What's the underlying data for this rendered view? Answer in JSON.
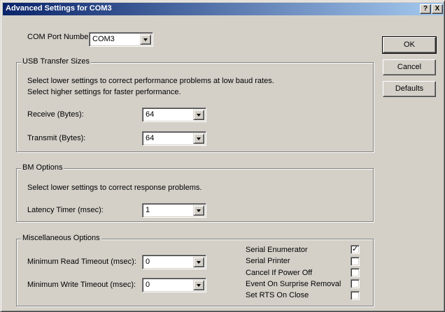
{
  "window": {
    "title": "Advanced Settings for COM3",
    "help_glyph": "?",
    "close_glyph": "X"
  },
  "com_port": {
    "label": "COM Port Number:",
    "value": "COM3"
  },
  "usb": {
    "legend": "USB Transfer Sizes",
    "hint1": "Select lower settings to correct performance problems at low baud rates.",
    "hint2": "Select higher settings for faster performance.",
    "receive_label": "Receive (Bytes):",
    "receive_value": "64",
    "transmit_label": "Transmit (Bytes):",
    "transmit_value": "64"
  },
  "bm": {
    "legend": "BM Options",
    "hint": "Select lower settings to correct response problems.",
    "latency_label": "Latency Timer (msec):",
    "latency_value": "1"
  },
  "misc": {
    "legend": "Miscellaneous Options",
    "read_label": "Minimum Read Timeout (msec):",
    "read_value": "0",
    "write_label": "Minimum Write Timeout (msec):",
    "write_value": "0",
    "options": [
      {
        "label": "Serial Enumerator",
        "checked": true
      },
      {
        "label": "Serial Printer",
        "checked": false
      },
      {
        "label": "Cancel If Power Off",
        "checked": false
      },
      {
        "label": "Event On Surprise Removal",
        "checked": false
      },
      {
        "label": "Set RTS On Close",
        "checked": false
      }
    ]
  },
  "buttons": {
    "ok": "OK",
    "cancel": "Cancel",
    "defaults": "Defaults"
  },
  "colors": {
    "face": "#d4d0c8",
    "title_start": "#0a246a",
    "title_end": "#a6caf0"
  }
}
